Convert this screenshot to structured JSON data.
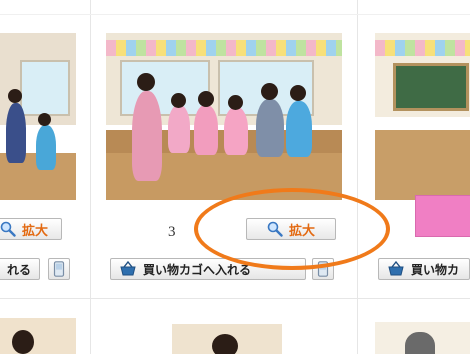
{
  "gallery": {
    "zoom_label": "拡大",
    "cart_label": "買い物カゴへ入れる",
    "cells": [
      {
        "number": ""
      },
      {
        "number": "3"
      },
      {
        "number": ""
      }
    ],
    "left_zoom_label": "拡大",
    "left_cart_label": "れる",
    "right_cart_label": "買い物カ"
  },
  "icons": {
    "zoom": "magnifier-icon",
    "cart": "shopping-basket-icon",
    "phone": "mobile-phone-icon"
  },
  "colors": {
    "highlight_ring": "#f07a1a",
    "zoom_text": "#e36a12",
    "pink_box": "#f07fc4"
  }
}
